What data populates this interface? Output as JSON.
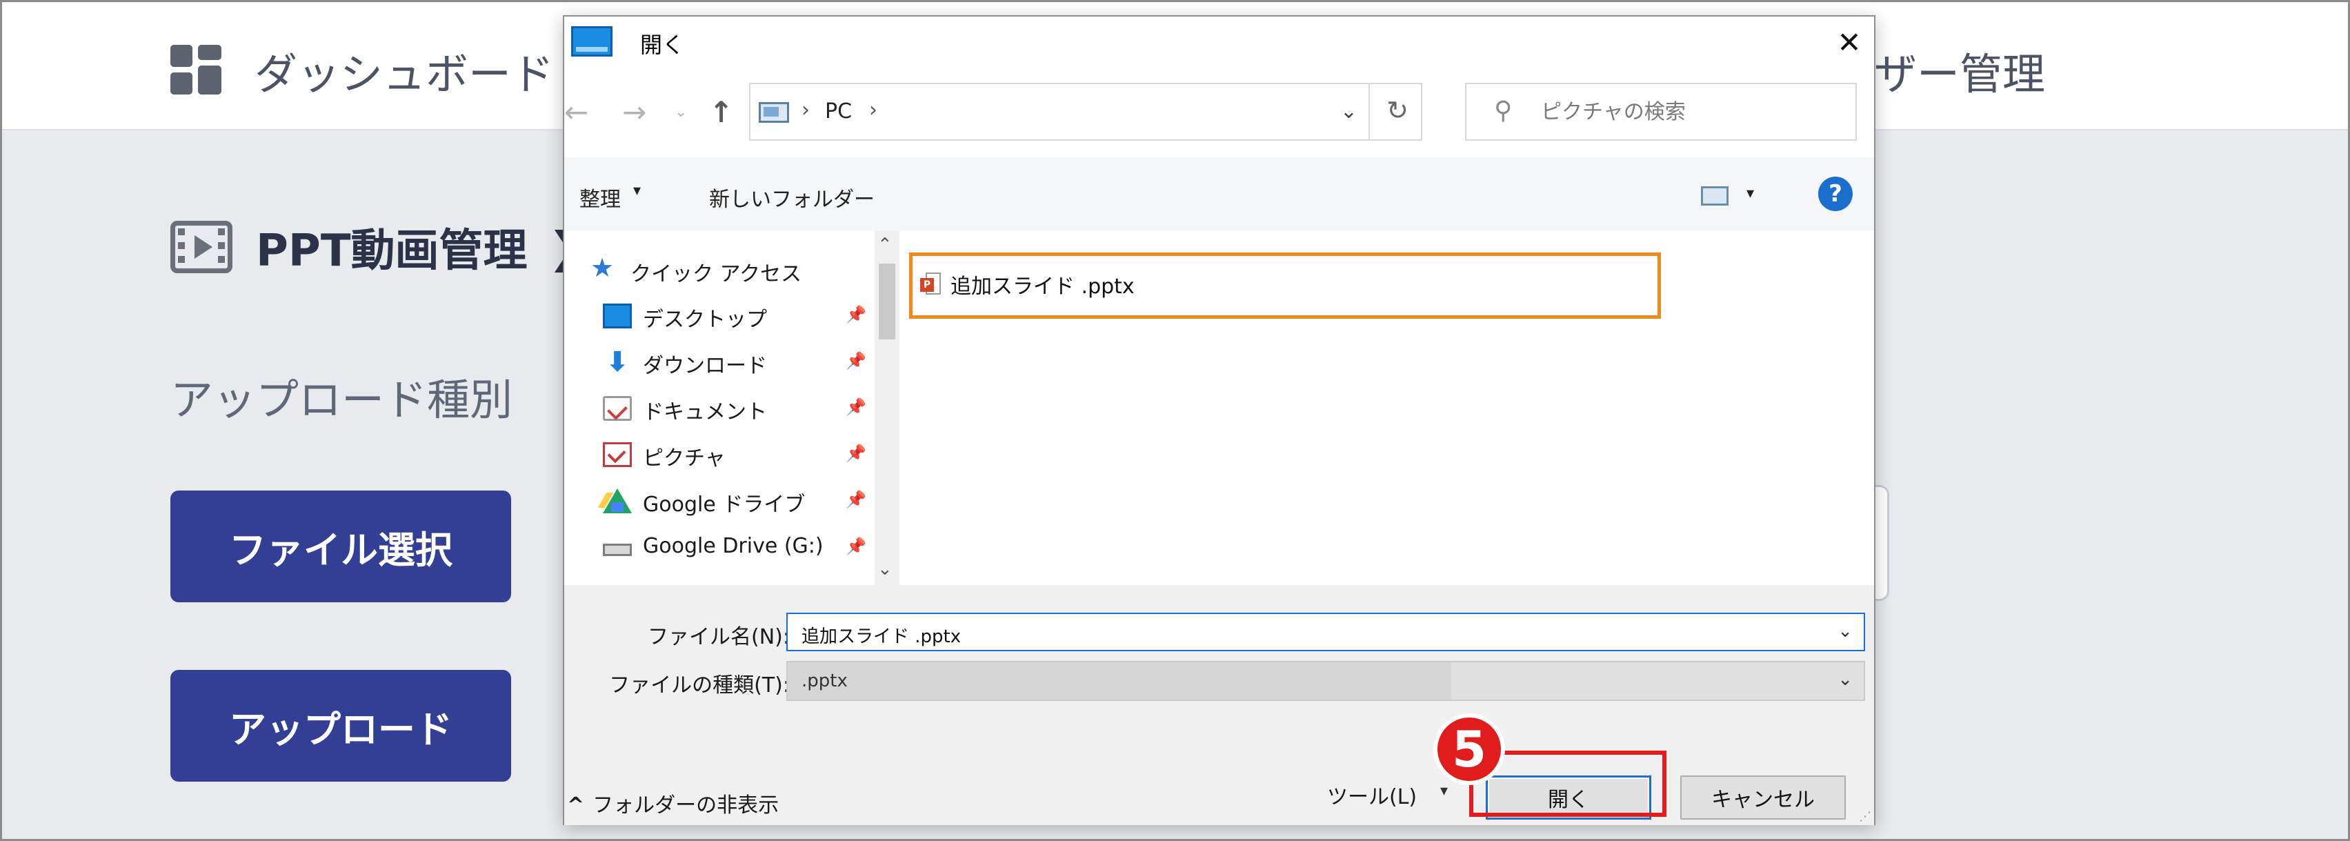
{
  "background_app": {
    "nav": {
      "dashboard_label": "ダッシュボード",
      "user_management_label": "ザー管理"
    },
    "section": {
      "title": "PPT動画管理",
      "chevron": "❯"
    },
    "upload_type_label": "アップロード種別",
    "buttons": {
      "file_select": "ファイル選択",
      "upload": "アップロード"
    },
    "colors": {
      "primary_button": "#323f94",
      "page_background": "#e8eaee"
    }
  },
  "dialog": {
    "title": "開く",
    "close_glyph": "✕",
    "navigation": {
      "back_glyph": "←",
      "forward_glyph": "→",
      "recent_glyph": "⌄",
      "up_glyph": "↑",
      "separator": "›",
      "address": "PC",
      "dropdown_glyph": "⌄",
      "refresh_glyph": "↻"
    },
    "search": {
      "icon": "search-icon",
      "placeholder": "ピクチャの検索"
    },
    "toolbar": {
      "organize_label": "整理",
      "caret": "▾",
      "new_folder_label": "新しいフォルダー",
      "help_label": "?"
    },
    "nav_pane": {
      "quick_access": {
        "label": "クイック アクセス",
        "icon": "star-icon"
      },
      "items": [
        {
          "label": "デスクトップ",
          "icon": "desktop-icon",
          "pinned": true
        },
        {
          "label": "ダウンロード",
          "icon": "download-icon",
          "pinned": true
        },
        {
          "label": "ドキュメント",
          "icon": "documents-icon",
          "pinned": true
        },
        {
          "label": "ピクチャ",
          "icon": "pictures-icon",
          "pinned": true
        },
        {
          "label": "Google ドライブ",
          "icon": "google-drive-icon",
          "pinned": true
        },
        {
          "label": "Google Drive (G:)",
          "icon": "drive-icon",
          "pinned": true
        }
      ],
      "pin_glyph": "📌",
      "scroll_up_glyph": "⌃",
      "scroll_down_glyph": "⌄"
    },
    "files": [
      {
        "name": "追加スライド .pptx",
        "icon": "powerpoint-file-icon",
        "highlighted": true
      }
    ],
    "filename": {
      "label": "ファイル名(N):",
      "value": "追加スライド .pptx",
      "caret": "⌄"
    },
    "filetype": {
      "label": "ファイルの種類(T):",
      "value": ".pptx",
      "caret": "⌄"
    },
    "footer": {
      "hide_folders_label": "フォルダーの非表示",
      "hide_folders_chevron": "^",
      "tools_label": "ツール(L)",
      "tools_caret": "▾",
      "open_label": "開く",
      "cancel_label": "キャンセル",
      "resize_glyph": "⋰"
    },
    "colors": {
      "highlight_orange": "#f08a1c",
      "focus_blue": "#1c6fd1"
    }
  },
  "annotation": {
    "step_number": "5",
    "color": "#e11c1c"
  }
}
